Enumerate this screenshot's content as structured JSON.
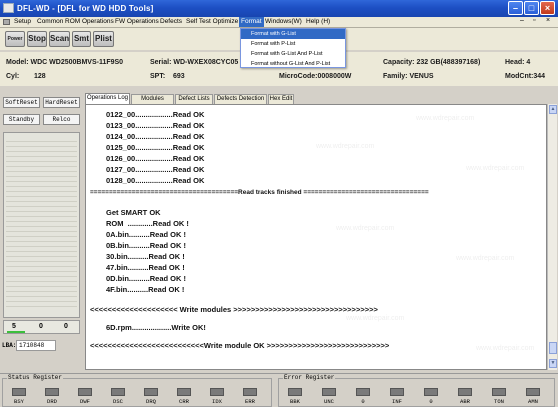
{
  "window": {
    "title": "DFL-WD - [DFL for WD HDD Tools]"
  },
  "menu": [
    "Setup",
    "Common",
    "ROM Operations",
    "FW Operations",
    "Defects",
    "Self Test Optimize",
    "Format",
    "Windows(W)",
    "Help (H)"
  ],
  "format_menu": [
    "Format with G-List",
    "Format with P-List",
    "Format with G-List And P-List",
    "Format without G-List And P-List"
  ],
  "toolbar": [
    "Power",
    "Stop",
    "Scan",
    "Smt",
    "Plist"
  ],
  "drive": {
    "model": "Model: WDC WD2500BMVS-11F9S0",
    "serial": "Serial: WD-WXEX08CYC05",
    "capacity": "Capacity: 232 GB(488397168)",
    "head": "Head:  4",
    "cyl_label": "Cyl:",
    "cyl_value": "128",
    "spt_label": "SPT:",
    "spt_value": "693",
    "microcode": "MicroCode:0008000W",
    "family": "Family:   VENUS",
    "modcnt": "ModCnt:344"
  },
  "left_buttons": [
    "SoftReset",
    "HardReset",
    "Standby",
    "Relco"
  ],
  "meter_values": [
    "5",
    "0",
    "0"
  ],
  "lba": {
    "label": "LBA:",
    "value": "1710848"
  },
  "tabs": [
    "Operations Log",
    "Modules Check",
    "Defect Lists",
    "Defects Detection",
    "Hex Edit"
  ],
  "log_lines": [
    "0122_00..................Read OK",
    "0123_00..................Read OK",
    "0124_00..................Read OK",
    "0125_00..................Read OK",
    "0126_00..................Read OK",
    "0127_00..................Read OK",
    "0128_00..................Read OK",
    "=======================================Read tracks finished =================================",
    "Get SMART OK",
    "ROM  ............Read OK !",
    "0A.bin..........Read OK !",
    "0B.bin..........Read OK !",
    "30.bin..........Read OK !",
    "47.bin..........Read OK !",
    "0D.bin..........Read OK !",
    "4F.bin..........Read OK !",
    "<<<<<<<<<<<<<<<<<<<< Write modules >>>>>>>>>>>>>>>>>>>>>>>>>>>>>>>>>",
    "6D.rpm...................Write OK!",
    "<<<<<<<<<<<<<<<<<<<<<<<<<<Write module OK >>>>>>>>>>>>>>>>>>>>>>>>>>>>"
  ],
  "watermark": "www.wdrepair.com",
  "status_register": {
    "title": "Status Register",
    "flags": [
      "BSY",
      "DRD",
      "DWF",
      "DSC",
      "DRQ",
      "CRR",
      "IDX",
      "ERR"
    ]
  },
  "error_register": {
    "title": "Error Register",
    "flags": [
      "BBK",
      "UNC",
      "0",
      "INF",
      "0",
      "ABR",
      "TON",
      "AMN"
    ]
  }
}
